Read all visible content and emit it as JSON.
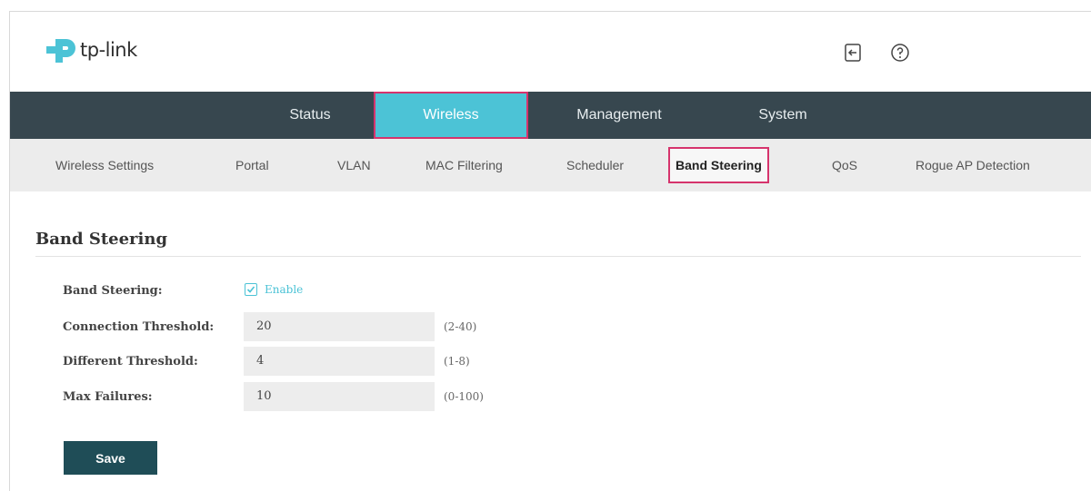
{
  "brand": {
    "name": "tp-link",
    "accent": "#4cc3d6",
    "logo_color": "#4cc3d6"
  },
  "header": {
    "icons": [
      "logout-icon",
      "help-icon"
    ]
  },
  "mainnav": {
    "tabs": [
      {
        "label": "Status"
      },
      {
        "label": "Wireless",
        "active": true
      },
      {
        "label": "Management"
      },
      {
        "label": "System"
      }
    ]
  },
  "subnav": {
    "items": [
      {
        "label": "Wireless Settings"
      },
      {
        "label": "Portal"
      },
      {
        "label": "VLAN"
      },
      {
        "label": "MAC Filtering"
      },
      {
        "label": "Scheduler"
      },
      {
        "label": "Band Steering",
        "active": true
      },
      {
        "label": "QoS"
      },
      {
        "label": "Rogue AP Detection"
      }
    ]
  },
  "section": {
    "title": "Band Steering",
    "band_steering": {
      "label": "Band Steering:",
      "checkbox_label": "Enable",
      "checked": true
    },
    "connection_threshold": {
      "label": "Connection Threshold:",
      "value": "20",
      "range": "(2-40)"
    },
    "different_threshold": {
      "label": "Different Threshold:",
      "value": "4",
      "range": "(1-8)"
    },
    "max_failures": {
      "label": "Max Failures:",
      "value": "10",
      "range": "(0-100)"
    },
    "save_label": "Save"
  },
  "colors": {
    "nav_bg": "#37474f",
    "subnav_bg": "#ececec",
    "highlight": "#d6336c",
    "button_bg": "#1f4d57"
  }
}
